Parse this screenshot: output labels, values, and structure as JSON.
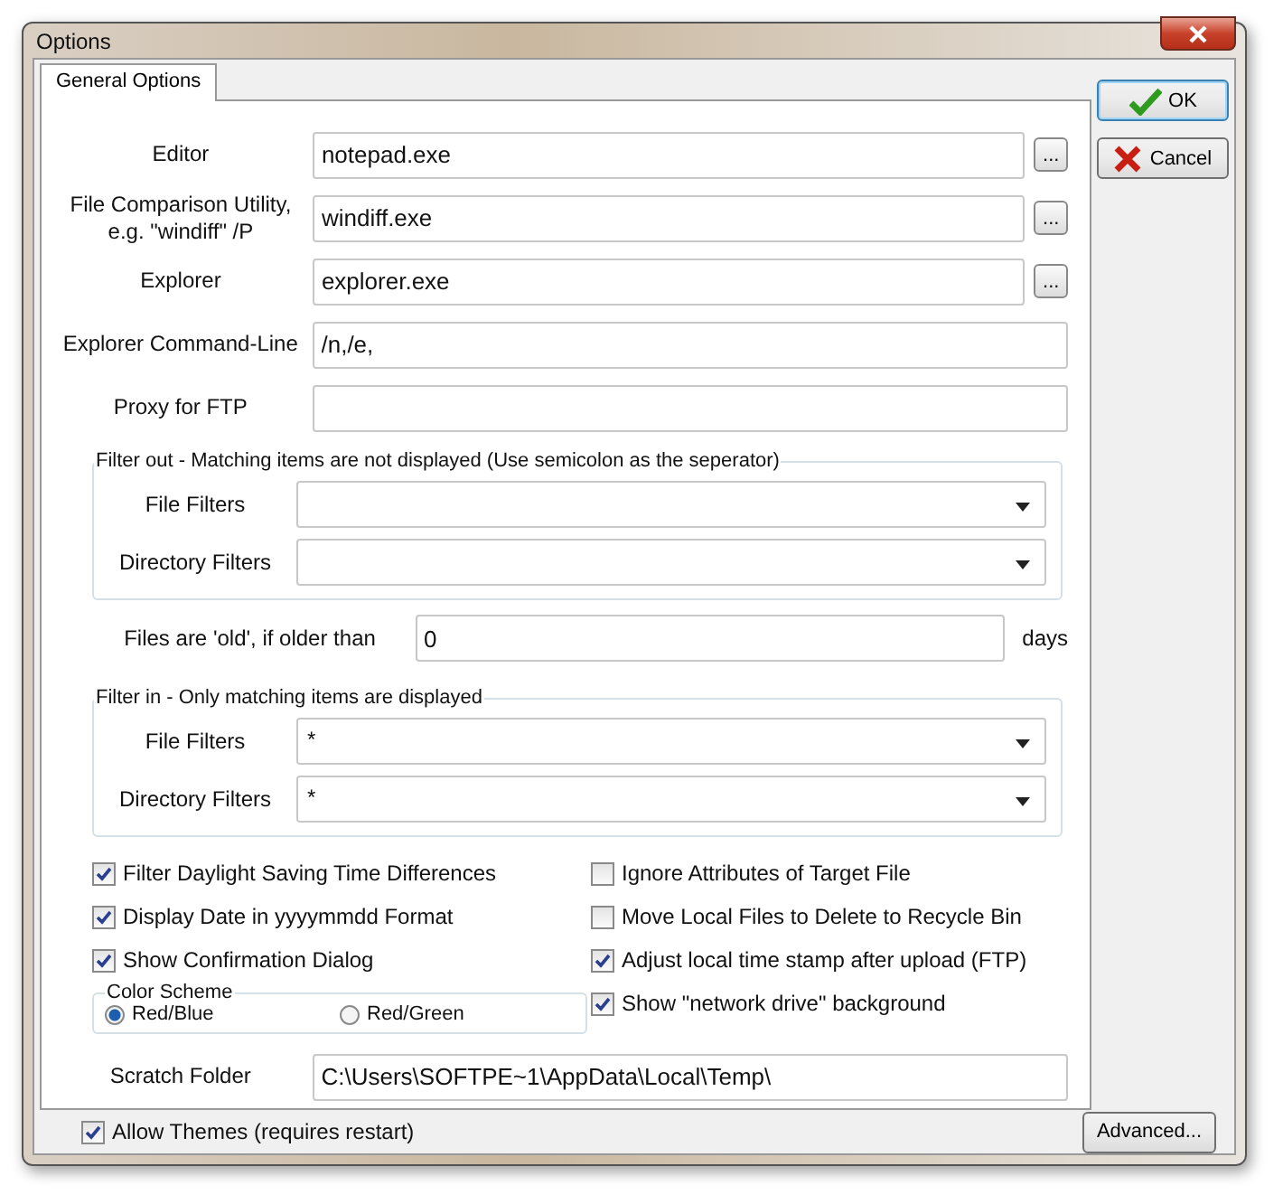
{
  "window": {
    "title": "Options"
  },
  "tabs": [
    {
      "label": "General Options",
      "selected": true
    }
  ],
  "paths": [
    {
      "kind": "browse",
      "label": "Editor",
      "value": "notepad.exe",
      "browse": "..."
    },
    {
      "kind": "browse",
      "label": "File Comparison Utility, e.g. \"windiff\" /P",
      "value": "windiff.exe",
      "browse": "..."
    },
    {
      "kind": "browse",
      "label": "Explorer",
      "value": "explorer.exe",
      "browse": "..."
    },
    {
      "kind": "plain",
      "label": "Explorer Command-Line",
      "value": "/n,/e,"
    },
    {
      "kind": "plain",
      "label": "Proxy for FTP"
    }
  ],
  "filter_out": {
    "title": "Filter out - Matching items are not displayed (Use semicolon as the seperator)",
    "rows": [
      {
        "label": "File Filters"
      },
      {
        "label": "Directory Filters"
      }
    ]
  },
  "old_files": {
    "label": "Files are 'old', if older than",
    "value": "0",
    "unit": "days"
  },
  "filter_in": {
    "title": "Filter in - Only matching items are displayed",
    "rows": [
      {
        "label": "File Filters",
        "value": "*"
      },
      {
        "label": "Directory Filters",
        "value": "*"
      }
    ]
  },
  "options_left": [
    {
      "label": "Filter Daylight Saving Time Differences",
      "checked": true
    },
    {
      "label": "Display Date in yyyymmdd Format",
      "checked": true
    },
    {
      "label": "Show Confirmation Dialog",
      "checked": true
    }
  ],
  "options_right": [
    {
      "label": "Ignore Attributes of Target File",
      "checked": false
    },
    {
      "label": "Move Local Files to Delete to Recycle Bin",
      "checked": false
    },
    {
      "label": "Adjust local time stamp after upload (FTP)",
      "checked": true
    },
    {
      "label": "Show \"network drive\" background",
      "checked": true
    }
  ],
  "color_scheme": {
    "title": "Color Scheme",
    "options": [
      {
        "label": "Red/Blue",
        "selected": true
      },
      {
        "label": "Red/Green",
        "selected": false
      }
    ]
  },
  "scratch_folder": {
    "label": "Scratch Folder",
    "value": "C:\\Users\\SOFTPE~1\\AppData\\Local\\Temp\\"
  },
  "allow_themes": {
    "label": "Allow Themes (requires restart)",
    "checked": true
  },
  "buttons": [
    {
      "kind": "ok",
      "label": "OK"
    },
    {
      "kind": "cancel",
      "label": "Cancel"
    }
  ],
  "advanced": {
    "label": "Advanced..."
  }
}
